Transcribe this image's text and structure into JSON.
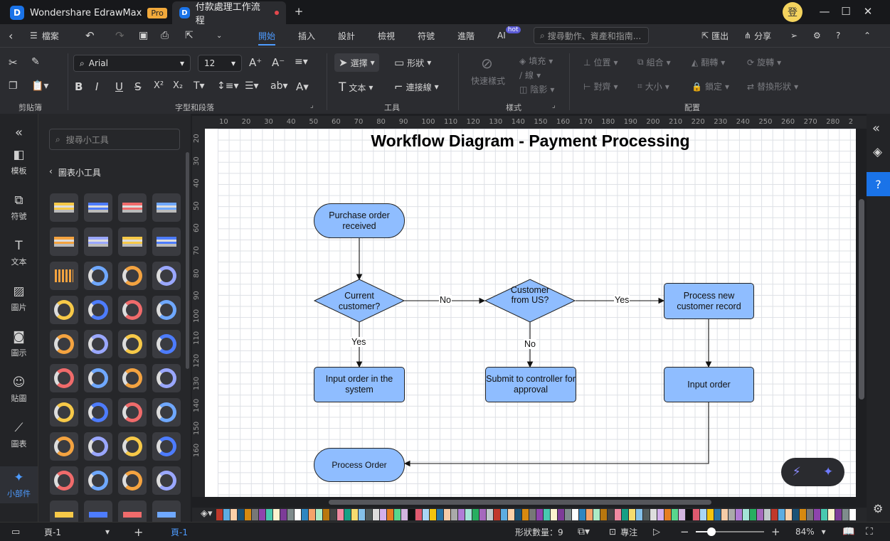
{
  "app": {
    "name": "Wondershare EdrawMax",
    "badge": "Pro",
    "doc_tab": "付款處理工作流程",
    "avatar": "登"
  },
  "menu": {
    "file": "檔案",
    "items": [
      "開始",
      "插入",
      "設計",
      "檢視",
      "符號",
      "進階"
    ],
    "ai": "AI",
    "ai_badge": "hot",
    "search_placeholder": "搜尋動作、資產和指南...",
    "export": "匯出",
    "share": "分享"
  },
  "ribbon": {
    "font_name": "Arial",
    "font_size": "12",
    "groups": {
      "clipboard": "剪貼簿",
      "font": "字型和段落",
      "tools": "工具",
      "style": "樣式",
      "arrange": "配置"
    },
    "tools": {
      "select": "選擇",
      "shape": "形狀",
      "text": "文本",
      "connector": "連接線"
    },
    "style": {
      "quick": "快速樣式",
      "fill": "填充",
      "line": "線",
      "shadow": "陰影"
    },
    "arrange": {
      "position": "位置",
      "group": "組合",
      "flip": "翻轉",
      "rotate": "旋轉",
      "align": "對齊",
      "size": "大小",
      "lock": "鎖定",
      "replace": "替換形狀"
    }
  },
  "leftnav": [
    {
      "label": "模板",
      "icon": "template-icon"
    },
    {
      "label": "符號",
      "icon": "symbol-icon"
    },
    {
      "label": "文本",
      "icon": "text-icon"
    },
    {
      "label": "圖片",
      "icon": "image-icon"
    },
    {
      "label": "圖示",
      "icon": "icon-icon"
    },
    {
      "label": "貼圖",
      "icon": "sticker-icon"
    },
    {
      "label": "圖表",
      "icon": "chart-icon"
    },
    {
      "label": "小部件",
      "icon": "widget-icon"
    }
  ],
  "panel": {
    "search_placeholder": "搜尋小工具",
    "back_label": "圖表小工具"
  },
  "ruler": {
    "h": [
      "10",
      "20",
      "30",
      "40",
      "50",
      "60",
      "70",
      "80",
      "90",
      "100",
      "110",
      "120",
      "130",
      "140",
      "150",
      "160",
      "170",
      "180",
      "190",
      "200",
      "210",
      "220",
      "230",
      "240",
      "250",
      "260",
      "270",
      "280",
      "2"
    ],
    "v": [
      "20",
      "30",
      "40",
      "50",
      "60",
      "70",
      "80",
      "90",
      "100",
      "110",
      "120",
      "130",
      "140",
      "150",
      "160"
    ]
  },
  "diagram": {
    "title": "Workflow Diagram - Payment Processing",
    "shapes": {
      "purchase": "Purchase  order received",
      "current": "Current customer?",
      "us": "Customer from US?",
      "process_new": "Process new customer  record",
      "input_system": "Input order in the system",
      "submit": "Submit to controller for approval",
      "input_order": "Input order",
      "process_order": "Process Order"
    },
    "labels": {
      "no1": "No",
      "yes1": "Yes",
      "yes2": "Yes",
      "no2": "No"
    }
  },
  "status": {
    "page_select": "頁-1",
    "page_tab": "頁-1",
    "shape_count": "形狀數量：9",
    "focus": "專注",
    "zoom": "84%"
  },
  "colors": {
    "shape_fill": "#8fbdff",
    "accent": "#4d9bff",
    "pro_badge": "#f2a93b"
  }
}
